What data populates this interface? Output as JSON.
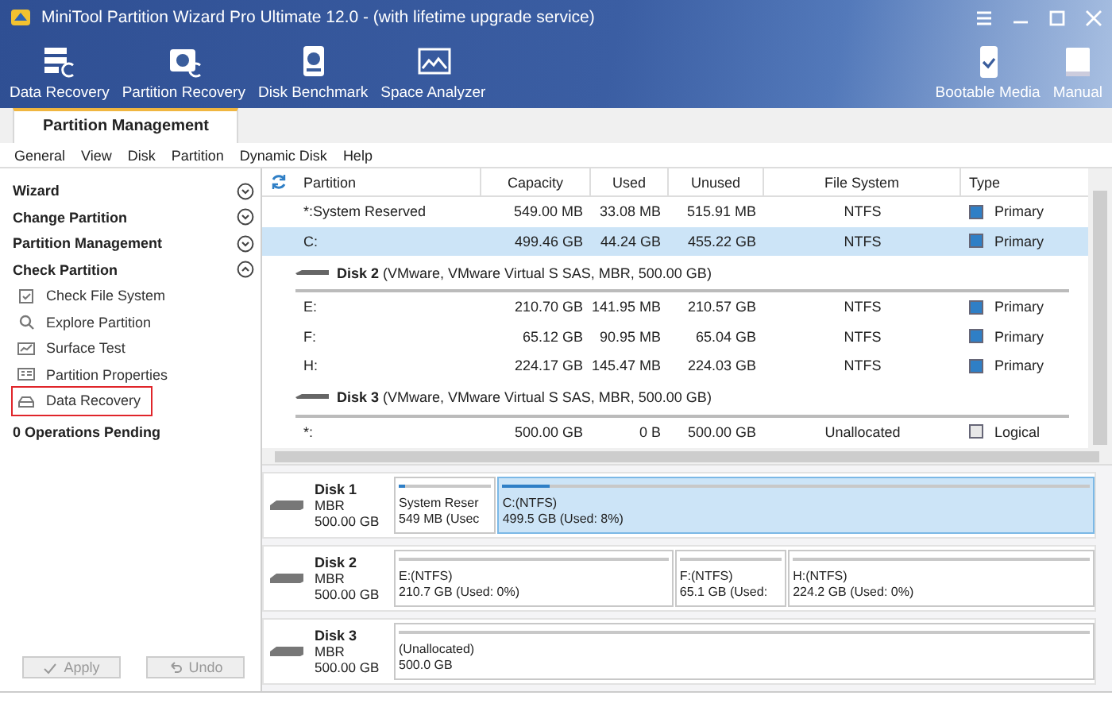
{
  "window": {
    "title": "MiniTool Partition Wizard Pro Ultimate 12.0 - (with lifetime upgrade service)"
  },
  "toolbar": {
    "items": [
      {
        "label": "Data Recovery",
        "kind": "data-recovery"
      },
      {
        "label": "Partition Recovery",
        "kind": "partition-recovery"
      },
      {
        "label": "Disk Benchmark",
        "kind": "benchmark"
      },
      {
        "label": "Space Analyzer",
        "kind": "analyzer"
      },
      {
        "label": "Bootable Media",
        "kind": "bootable"
      },
      {
        "label": "Manual",
        "kind": "manual"
      }
    ]
  },
  "tabs": [
    {
      "label": "Partition Management",
      "selected": true
    }
  ],
  "menu": [
    "General",
    "View",
    "Disk",
    "Partition",
    "Dynamic Disk",
    "Help"
  ],
  "sidebar": {
    "sections": [
      {
        "label": "Wizard",
        "expanded": false
      },
      {
        "label": "Change Partition",
        "expanded": false
      },
      {
        "label": "Partition Management",
        "expanded": false
      },
      {
        "label": "Check Partition",
        "expanded": true,
        "items": [
          {
            "label": "Check File System",
            "kind": "check",
            "highlighted": false
          },
          {
            "label": "Explore Partition",
            "kind": "explore",
            "highlighted": false
          },
          {
            "label": "Surface Test",
            "kind": "surface",
            "highlighted": false
          },
          {
            "label": "Partition Properties",
            "kind": "properties",
            "highlighted": false
          },
          {
            "label": "Data Recovery",
            "kind": "recovery",
            "highlighted": true
          }
        ]
      }
    ],
    "pending": "0 Operations Pending",
    "buttons": [
      {
        "label": "Apply",
        "kind": "apply",
        "disabled": true
      },
      {
        "label": "Undo",
        "kind": "undo",
        "disabled": true
      }
    ]
  },
  "table": {
    "columns": [
      "Partition",
      "Capacity",
      "Used",
      "Unused",
      "File System",
      "Type"
    ],
    "rows": [
      {
        "kind": "partition",
        "cells": [
          "*:System Reserved",
          "549.00 MB",
          "33.08 MB",
          "515.91 MB",
          "NTFS",
          "Primary"
        ],
        "color": "#2f7fc6",
        "selected": false
      },
      {
        "kind": "partition",
        "cells": [
          "C:",
          "499.46 GB",
          "44.24 GB",
          "455.22 GB",
          "NTFS",
          "Primary"
        ],
        "color": "#2f7fc6",
        "selected": true
      },
      {
        "kind": "disk",
        "name": "Disk 2",
        "detail": "(VMware, VMware Virtual S SAS, MBR, 500.00 GB)"
      },
      {
        "kind": "partition",
        "cells": [
          "E:",
          "210.70 GB",
          "141.95 MB",
          "210.57 GB",
          "NTFS",
          "Primary"
        ],
        "color": "#2f7fc6",
        "selected": false
      },
      {
        "kind": "partition",
        "cells": [
          "F:",
          "65.12 GB",
          "90.95 MB",
          "65.04 GB",
          "NTFS",
          "Primary"
        ],
        "color": "#2f7fc6",
        "selected": false
      },
      {
        "kind": "partition",
        "cells": [
          "H:",
          "224.17 GB",
          "145.47 MB",
          "224.03 GB",
          "NTFS",
          "Primary"
        ],
        "color": "#2f7fc6",
        "selected": false
      },
      {
        "kind": "disk",
        "name": "Disk 3",
        "detail": "(VMware, VMware Virtual S SAS, MBR, 500.00 GB)"
      },
      {
        "kind": "partition",
        "cells": [
          "*:",
          "500.00 GB",
          "0 B",
          "500.00 GB",
          "Unallocated",
          "Logical"
        ],
        "color": "#e8e8e8",
        "selected": false
      }
    ]
  },
  "disk_map": {
    "disks": [
      {
        "name": "Disk 1",
        "scheme": "MBR",
        "size": "500.00 GB",
        "partitions": [
          {
            "label": "System Reser",
            "detail": "549 MB (Usec",
            "level": 0.06,
            "selected": false
          },
          {
            "label": "C:(NTFS)",
            "detail": "499.5 GB (Used: 8%)",
            "level": 0.08,
            "selected": true
          }
        ]
      },
      {
        "name": "Disk 2",
        "scheme": "MBR",
        "size": "500.00 GB",
        "partitions": [
          {
            "label": "E:(NTFS)",
            "detail": "210.7 GB (Used: 0%)",
            "level": 0,
            "selected": false
          },
          {
            "label": "F:(NTFS)",
            "detail": "65.1 GB (Used:",
            "level": 0,
            "selected": false
          },
          {
            "label": "H:(NTFS)",
            "detail": "224.2 GB (Used: 0%)",
            "level": 0,
            "selected": false
          }
        ]
      },
      {
        "name": "Disk 3",
        "scheme": "MBR",
        "size": "500.00 GB",
        "partitions": [
          {
            "label": "(Unallocated)",
            "detail": "500.0 GB",
            "level": 0,
            "selected": false
          }
        ]
      }
    ]
  }
}
